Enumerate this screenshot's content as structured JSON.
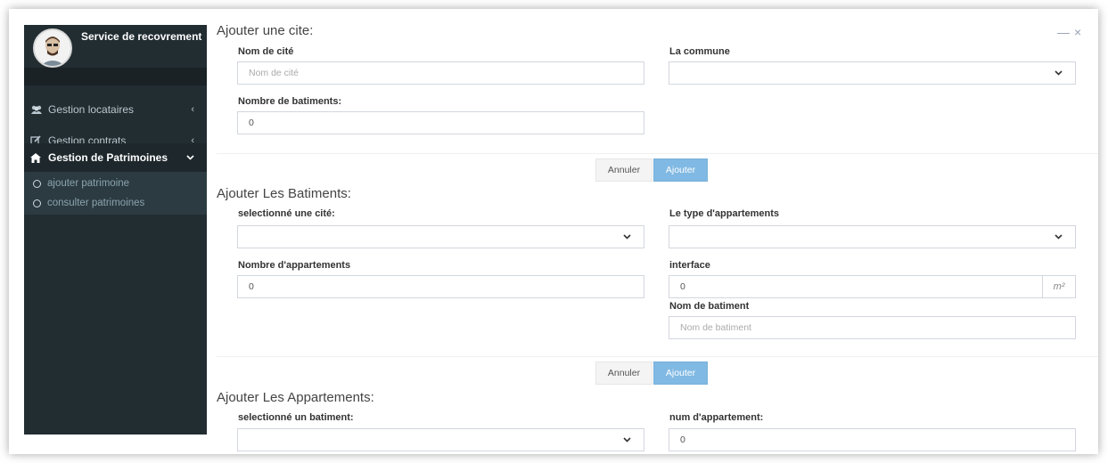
{
  "sidebar": {
    "brand_title": "Service de recovrement",
    "menu": [
      {
        "label": "Gestion locataires",
        "icon": "users-icon"
      },
      {
        "label": "Gestion contrats",
        "icon": "edit-icon"
      },
      {
        "label": "Gestion de Patrimoines",
        "icon": "home-icon"
      }
    ],
    "submenu": [
      {
        "label": "ajouter patrimoine"
      },
      {
        "label": "consulter patrimoines"
      }
    ]
  },
  "window": {
    "minimize": "—",
    "close": "×"
  },
  "cite": {
    "title": "Ajouter une cite:",
    "nom_label": "Nom de cité",
    "nom_placeholder": "Nom de cité",
    "commune_label": "La commune",
    "commune_value": "",
    "nb_batiments_label": "Nombre de batiments:",
    "nb_batiments_value": "0",
    "cancel": "Annuler",
    "add": "Ajouter"
  },
  "batiments": {
    "title": "Ajouter Les Batiments:",
    "cite_label": "selectionné une cité:",
    "cite_value": "",
    "type_label": "Le type d'appartements",
    "type_value": "",
    "nb_appart_label": "Nombre d'appartements",
    "nb_appart_value": "0",
    "interface_label": "interface",
    "interface_value": "0",
    "interface_unit": "m²",
    "nom_label": "Nom de batiment",
    "nom_placeholder": "Nom de batiment",
    "cancel": "Annuler",
    "add": "Ajouter"
  },
  "appartements": {
    "title": "Ajouter Les Appartements:",
    "batiment_label": "selectionné un batiment:",
    "batiment_value": "",
    "num_label": "num d'appartement:",
    "num_value": "0"
  },
  "colors": {
    "sidebar_bg": "#222d32",
    "sidebar_active": "#1e282c",
    "primary_button": "#80b9e3"
  }
}
